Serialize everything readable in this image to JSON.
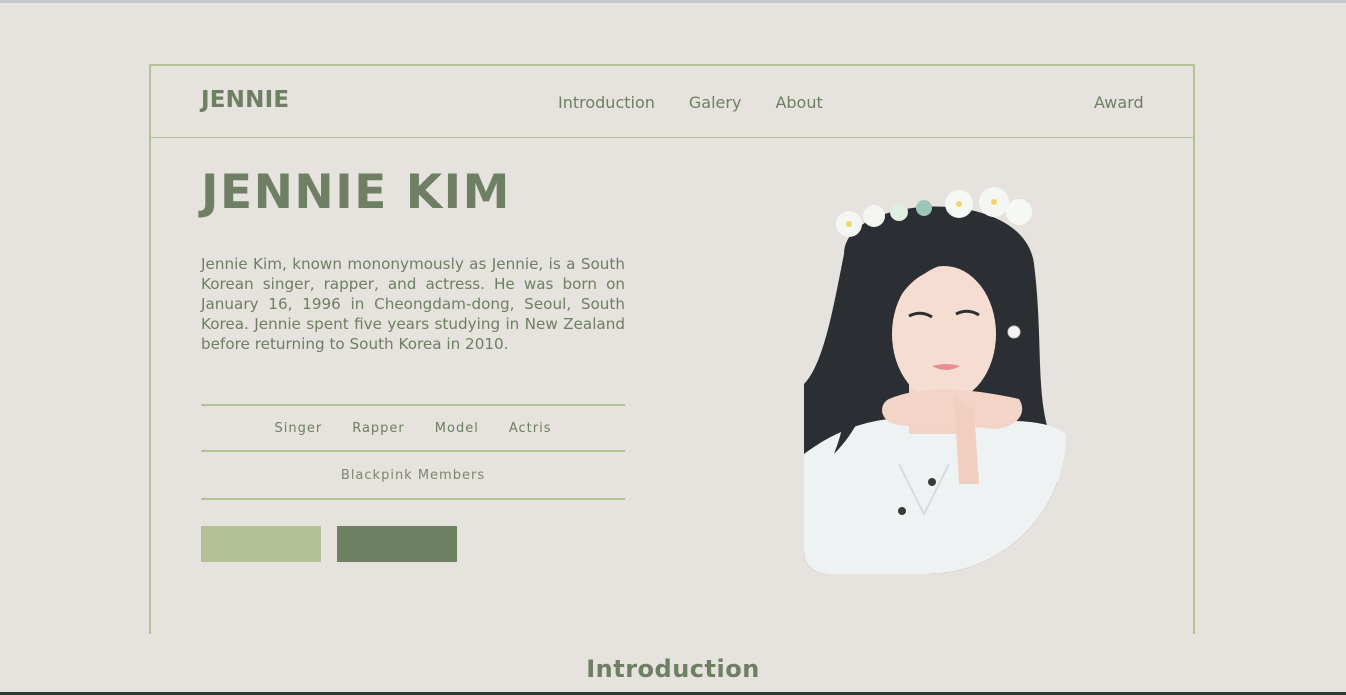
{
  "nav": {
    "logo": "JENNIE",
    "links": [
      "Introduction",
      "Galery",
      "About"
    ],
    "award": "Award"
  },
  "hero": {
    "title": "JENNIE KIM",
    "description": "Jennie Kim, known mononymously as Jennie, is a South Korean singer, rapper, and actress. He was born on January 16, 1996 in Cheongdam-dong, Seoul, South Korea. Jennie spent five years studying in New Zealand before returning to South Korea in 2010.",
    "roles": [
      "Singer",
      "Rapper",
      "Model",
      "Actris"
    ],
    "members_label": "Blackpink Members"
  },
  "section": {
    "title": "Introduction"
  },
  "colors": {
    "background": "#e6e2dd",
    "primary": "#6e7f63",
    "accent_light": "#b3c196",
    "accent_dark": "#6e8163"
  }
}
